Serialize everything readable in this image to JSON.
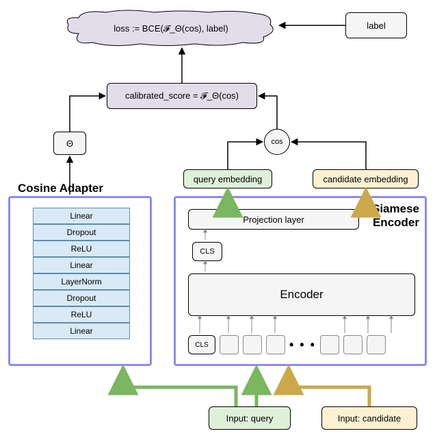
{
  "loss": {
    "text": "loss := BCE(𝓕_Θ(cos), label)"
  },
  "label_box": "label",
  "calibrated_box": "calibrated_score = 𝓕_Θ(cos)",
  "theta_box": "Θ",
  "cos_circle": "cos",
  "query_embedding": "query embedding",
  "candidate_embedding": "candidate embedding",
  "cosine_adapter": {
    "title": "Cosine Adapter",
    "layers": [
      "Linear",
      "Dropout",
      "ReLU",
      "Linear",
      "LayerNorm",
      "Dropout",
      "ReLU",
      "Linear"
    ]
  },
  "siamese_encoder": {
    "title": "Siamese\nEncoder",
    "projection": "Projection layer",
    "cls": "CLS",
    "encoder": "Encoder",
    "cls_token": "CLS"
  },
  "inputs": {
    "query": "Input: query",
    "candidate": "Input: candidate"
  },
  "chart_data": {
    "type": "diagram",
    "nodes": [
      {
        "id": "input_query",
        "label": "Input: query",
        "type": "input"
      },
      {
        "id": "input_candidate",
        "label": "Input: candidate",
        "type": "input"
      },
      {
        "id": "cosine_adapter",
        "label": "Cosine Adapter",
        "type": "module",
        "layers": [
          "Linear",
          "Dropout",
          "ReLU",
          "Linear",
          "LayerNorm",
          "Dropout",
          "ReLU",
          "Linear"
        ]
      },
      {
        "id": "siamese_encoder",
        "label": "Siamese Encoder",
        "type": "module",
        "components": [
          "CLS token row",
          "Encoder",
          "CLS",
          "Projection layer"
        ]
      },
      {
        "id": "query_embedding",
        "label": "query embedding",
        "type": "embedding"
      },
      {
        "id": "candidate_embedding",
        "label": "candidate embedding",
        "type": "embedding"
      },
      {
        "id": "theta",
        "label": "Θ",
        "type": "parameter"
      },
      {
        "id": "cos",
        "label": "cos",
        "type": "operation"
      },
      {
        "id": "calibrated_score",
        "label": "calibrated_score = 𝓕_Θ(cos)",
        "type": "computation"
      },
      {
        "id": "label",
        "label": "label",
        "type": "input"
      },
      {
        "id": "loss",
        "label": "loss := BCE(𝓕_Θ(cos), label)",
        "type": "output"
      }
    ],
    "edges": [
      {
        "from": "input_query",
        "to": "cosine_adapter",
        "color": "green"
      },
      {
        "from": "input_query",
        "to": "siamese_encoder",
        "color": "green"
      },
      {
        "from": "input_candidate",
        "to": "siamese_encoder",
        "color": "yellow"
      },
      {
        "from": "siamese_encoder",
        "to": "query_embedding",
        "color": "green"
      },
      {
        "from": "siamese_encoder",
        "to": "candidate_embedding",
        "color": "yellow"
      },
      {
        "from": "cosine_adapter",
        "to": "theta",
        "color": "black"
      },
      {
        "from": "query_embedding",
        "to": "cos",
        "color": "black"
      },
      {
        "from": "candidate_embedding",
        "to": "cos",
        "color": "black"
      },
      {
        "from": "theta",
        "to": "calibrated_score",
        "color": "black"
      },
      {
        "from": "cos",
        "to": "calibrated_score",
        "color": "black"
      },
      {
        "from": "calibrated_score",
        "to": "loss",
        "color": "black"
      },
      {
        "from": "label",
        "to": "loss",
        "color": "black"
      }
    ]
  }
}
